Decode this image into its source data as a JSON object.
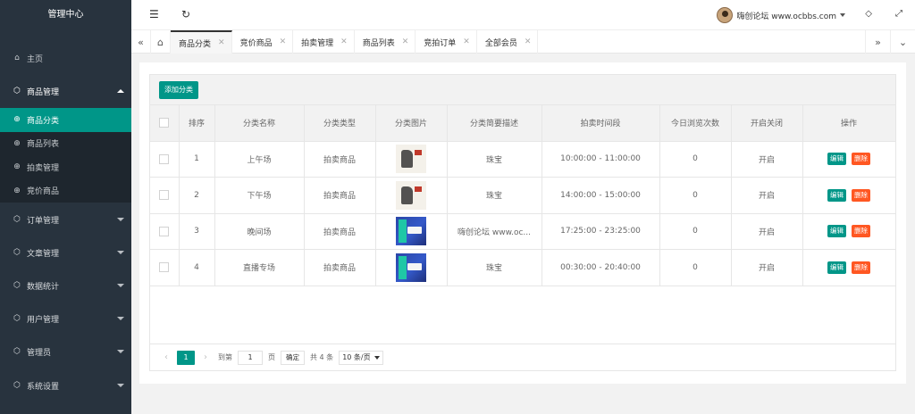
{
  "sidebar": {
    "logo": "管理中心",
    "home": "主页",
    "groups": [
      {
        "label": "商品管理"
      },
      {
        "label": "订单管理"
      },
      {
        "label": "文章管理"
      },
      {
        "label": "数据统计"
      },
      {
        "label": "用户管理"
      },
      {
        "label": "管理员"
      },
      {
        "label": "系统设置"
      }
    ],
    "submenu": [
      {
        "label": "商品分类"
      },
      {
        "label": "商品列表"
      },
      {
        "label": "拍卖管理"
      },
      {
        "label": "竞价商品"
      }
    ]
  },
  "header": {
    "user": "嗨创论坛 www.ocbbs.com"
  },
  "tabs": [
    {
      "label": "商品分类"
    },
    {
      "label": "竞价商品"
    },
    {
      "label": "拍卖管理"
    },
    {
      "label": "商品列表"
    },
    {
      "label": "竞拍订单"
    },
    {
      "label": "全部会员"
    }
  ],
  "toolbar": {
    "add_label": "添加分类"
  },
  "table": {
    "headers": [
      "排序",
      "分类名称",
      "分类类型",
      "分类图片",
      "分类简要描述",
      "拍卖时间段",
      "今日浏览次数",
      "开启关闭",
      "操作"
    ],
    "edit_label": "编辑",
    "delete_label": "删除",
    "rows": [
      {
        "order": "1",
        "name": "上午场",
        "type": "拍卖商品",
        "image": "ink",
        "desc": "珠宝",
        "time": "10:00:00 - 11:00:00",
        "views": "0",
        "status": "开启"
      },
      {
        "order": "2",
        "name": "下午场",
        "type": "拍卖商品",
        "image": "ink",
        "desc": "珠宝",
        "time": "14:00:00 - 15:00:00",
        "views": "0",
        "status": "开启"
      },
      {
        "order": "3",
        "name": "晚间场",
        "type": "拍卖商品",
        "image": "poster",
        "desc": "嗨创论坛 www.oc...",
        "time": "17:25:00 - 23:25:00",
        "views": "0",
        "status": "开启"
      },
      {
        "order": "4",
        "name": "直播专场",
        "type": "拍卖商品",
        "image": "poster",
        "desc": "珠宝",
        "time": "00:30:00 - 20:40:00",
        "views": "0",
        "status": "开启"
      }
    ]
  },
  "pager": {
    "current": "1",
    "goto_label": "到第",
    "goto_value": "1",
    "page_unit": "页",
    "ok_label": "确定",
    "total": "共 4 条",
    "page_size": "10 条/页"
  }
}
